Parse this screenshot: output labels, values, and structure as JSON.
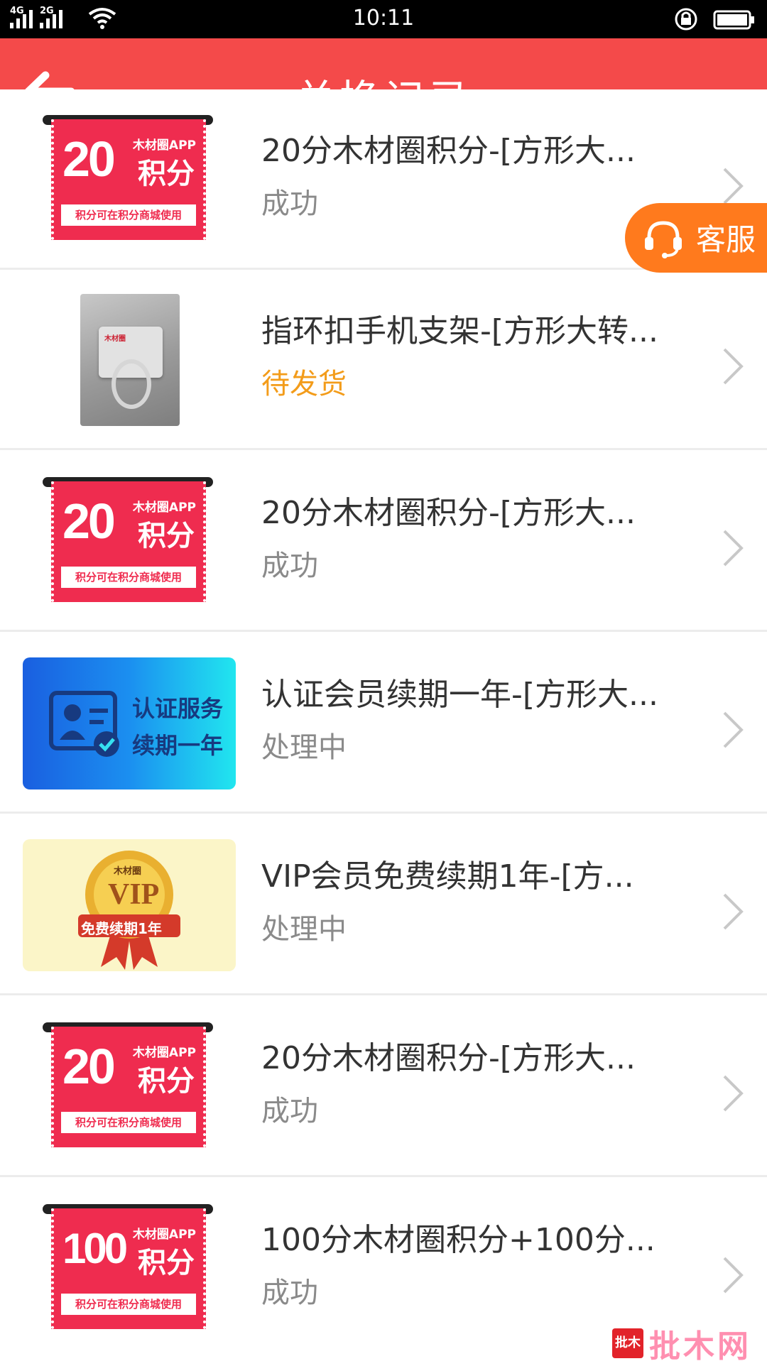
{
  "status_bar": {
    "network_1": "4G",
    "network_2": "2G",
    "time": "10:11"
  },
  "header": {
    "title": "兑换记录"
  },
  "floating": {
    "kefu_label": "客服"
  },
  "items": [
    {
      "title": "20分木材圈积分-[方形大...",
      "status": "成功",
      "thumb": {
        "type": "coupon",
        "number": "20",
        "brand": "木材圈APP",
        "unit": "积分",
        "note": "积分可在积分商城使用"
      }
    },
    {
      "title": "指环扣手机支架-[方形大转...",
      "status": "待发货",
      "thumb": {
        "type": "photo",
        "logo": "木材圈"
      }
    },
    {
      "title": "20分木材圈积分-[方形大...",
      "status": "成功",
      "thumb": {
        "type": "coupon",
        "number": "20",
        "brand": "木材圈APP",
        "unit": "积分",
        "note": "积分可在积分商城使用"
      }
    },
    {
      "title": "认证会员续期一年-[方形大...",
      "status": "处理中",
      "thumb": {
        "type": "cert",
        "line1": "认证服务",
        "line2": "续期一年"
      }
    },
    {
      "title": "VIP会员免费续期1年-[方...",
      "status": "处理中",
      "thumb": {
        "type": "vip",
        "brand": "木材圈",
        "badge": "VIP",
        "ribbon": "免费续期1年"
      }
    },
    {
      "title": "20分木材圈积分-[方形大...",
      "status": "成功",
      "thumb": {
        "type": "coupon",
        "number": "20",
        "brand": "木材圈APP",
        "unit": "积分",
        "note": "积分可在积分商城使用"
      }
    },
    {
      "title": "100分木材圈积分+100分...",
      "status": "成功",
      "thumb": {
        "type": "coupon",
        "number": "100",
        "brand": "木材圈APP",
        "unit": "积分",
        "note": "积分可在积分商城使用"
      }
    }
  ],
  "watermark": {
    "badge": "批木",
    "text": "批木网"
  },
  "colors": {
    "header_bg": "#f44a4a",
    "kefu_bg": "#ff7a1d",
    "pending_status": "#f39c1a",
    "coupon_red": "#ef2c4f"
  }
}
